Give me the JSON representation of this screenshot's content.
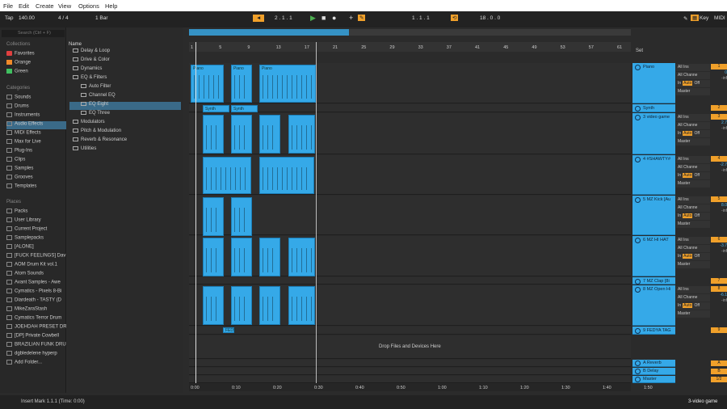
{
  "menu": [
    "File",
    "Edit",
    "Create",
    "View",
    "Options",
    "Help"
  ],
  "control": {
    "tap": "Tap",
    "tempo": "140.00",
    "sig": "4 / 4",
    "quant": "1 Bar",
    "position": "2 . 1 . 1",
    "loop_start": "1 . 1 . 1",
    "loop_len": "18 . 0 . 0",
    "key": "Key",
    "midi": "MIDI"
  },
  "search_placeholder": "Search (Ctrl + F)",
  "collections": {
    "heading": "Collections",
    "items": [
      "Favorites",
      "Orange",
      "Green"
    ]
  },
  "categories": {
    "heading": "Categories",
    "items": [
      "Sounds",
      "Drums",
      "Instruments",
      "Audio Effects",
      "MIDI Effects",
      "Max for Live",
      "Plug-Ins",
      "Clips",
      "Samples",
      "Grooves",
      "Templates"
    ]
  },
  "places": {
    "heading": "Places",
    "items": [
      "Packs",
      "User Library",
      "Current Project",
      "Samplepacks",
      "[ALONE]",
      "[FUCK FEELINGS] Dav",
      "AOM Drum Kit vol.1",
      "Atom Sounds",
      "Avant Samples - Awe",
      "Cymatics - Pixels 8-Bi",
      "Diardeath - TASTY (D",
      "MikeZaraStash",
      "Cymatics Terror Drum",
      "JOEHDAH PRESET DR",
      "[DP] Private Cowbell",
      "BRAZILIAN FUNK DRU",
      "dgbledelene hyperp",
      "Add Folder..."
    ]
  },
  "browser": {
    "heading": "Name",
    "items": [
      "Delay & Loop",
      "Drive & Color",
      "Dynamics",
      "EQ & Filters",
      "Auto Filter",
      "Channel EQ",
      "EQ Eight",
      "EQ Three",
      "Modulators",
      "Pitch & Modulation",
      "Reverb & Resonance",
      "Utilities"
    ]
  },
  "ruler": [
    "1",
    "5",
    "9",
    "13",
    "17",
    "21",
    "25",
    "29",
    "33",
    "37",
    "41",
    "45",
    "49",
    "53",
    "57",
    "61"
  ],
  "time": [
    "0:00",
    "0:10",
    "0:20",
    "0:30",
    "0:40",
    "0:50",
    "1:00",
    "1:10",
    "1:20",
    "1:30",
    "1:40",
    "1:50"
  ],
  "set_label": "Set",
  "drop_text": "Drop Files and Devices Here",
  "tracks": [
    {
      "name": "Piano",
      "in": "All Ins",
      "ch": "All Channe",
      "mon": "Auto",
      "out": "Master",
      "num": "1",
      "vol": "0"
    },
    {
      "name": "Synth",
      "num": "2"
    },
    {
      "name": "3 video game",
      "in": "All Ins",
      "ch": "All Channe",
      "mon": "Auto",
      "out": "Master",
      "num": "3",
      "vol": "2.7"
    },
    {
      "name": "4 #SHAWTY#",
      "in": "All Ins",
      "ch": "All Channe",
      "mon": "Auto",
      "out": "Master",
      "num": "4",
      "vol": "-2.7"
    },
    {
      "name": "5 MZ Kick [Au",
      "in": "All Ins",
      "ch": "All Channe",
      "mon": "Auto",
      "out": "Master",
      "num": "5",
      "vol": "8.0"
    },
    {
      "name": "6 MZ HI HAT",
      "in": "All Ins",
      "ch": "All Channe",
      "mon": "Auto",
      "out": "Master",
      "num": "6",
      "vol": "-3.7"
    },
    {
      "name": "7 MZ Clap [8i",
      "num": "7"
    },
    {
      "name": "8 MZ Open Hi",
      "in": "All Ins",
      "ch": "All Channe",
      "mon": "Auto",
      "out": "Master",
      "num": "8",
      "vol": "-6.1"
    },
    {
      "name": "9 FEDYA TAG",
      "num": "9"
    }
  ],
  "returns": [
    {
      "name": "A Reverb",
      "num": "A"
    },
    {
      "name": "B Delay",
      "num": "B"
    },
    {
      "name": "Master",
      "num": "1/2"
    }
  ],
  "clip_labels": {
    "piano": "Piano",
    "synth": "Synth",
    "fedya": "FEDY"
  },
  "status": {
    "left": "Insert Mark 1.1.1 (Time: 0:00)",
    "right": "3-video game"
  },
  "io_labels": {
    "in": "In",
    "off": "Off",
    "inf": "-inf"
  }
}
